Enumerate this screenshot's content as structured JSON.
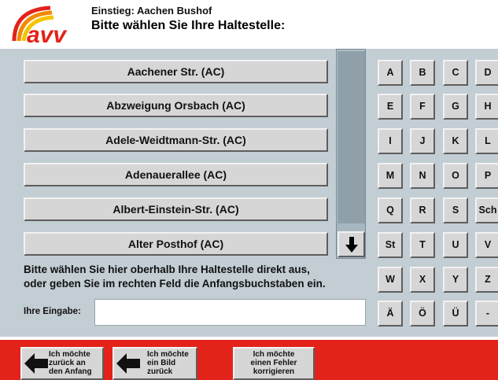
{
  "header": {
    "line1": "Einstieg: Aachen Bushof",
    "line2": "Bitte wählen Sie Ihre Haltestelle:",
    "logo_text": "avv"
  },
  "stops": [
    "Aachener Str. (AC)",
    "Abzweigung Orsbach (AC)",
    "Adele-Weidtmann-Str. (AC)",
    "Adenauerallee (AC)",
    "Albert-Einstein-Str. (AC)",
    "Alter Posthof (AC)"
  ],
  "scroll": {
    "down_icon": "down-arrow-icon"
  },
  "hint": {
    "line1": "Bitte wählen Sie hier oberhalb Ihre Haltestelle direkt aus,",
    "line2": "oder geben Sie im rechten Feld die Anfangsbuchstaben ein."
  },
  "input": {
    "label": "Ihre Eingabe:",
    "value": ""
  },
  "keys": [
    [
      "A",
      "B",
      "C",
      "D"
    ],
    [
      "E",
      "F",
      "G",
      "H"
    ],
    [
      "I",
      "J",
      "K",
      "L"
    ],
    [
      "M",
      "N",
      "O",
      "P"
    ],
    [
      "Q",
      "R",
      "S",
      "Sch"
    ],
    [
      "St",
      "T",
      "U",
      "V"
    ],
    [
      "W",
      "X",
      "Y",
      "Z"
    ],
    [
      "Ä",
      "Ö",
      "Ü",
      "-"
    ]
  ],
  "footer": {
    "back_to_start": {
      "line1": "Ich möchte",
      "line2": "zurück an",
      "line3": "den Anfang"
    },
    "back_one": {
      "line1": "Ich möchte",
      "line2": "ein Bild",
      "line3": "zurück"
    },
    "correct": {
      "line1": "Ich möchte",
      "line2": "einen Fehler",
      "line3": "korrigieren"
    }
  },
  "colors": {
    "panel_bg": "#c3cdd4",
    "footer_red": "#e3221a",
    "logo_orange": "#f18a00",
    "logo_red": "#e3221a"
  }
}
